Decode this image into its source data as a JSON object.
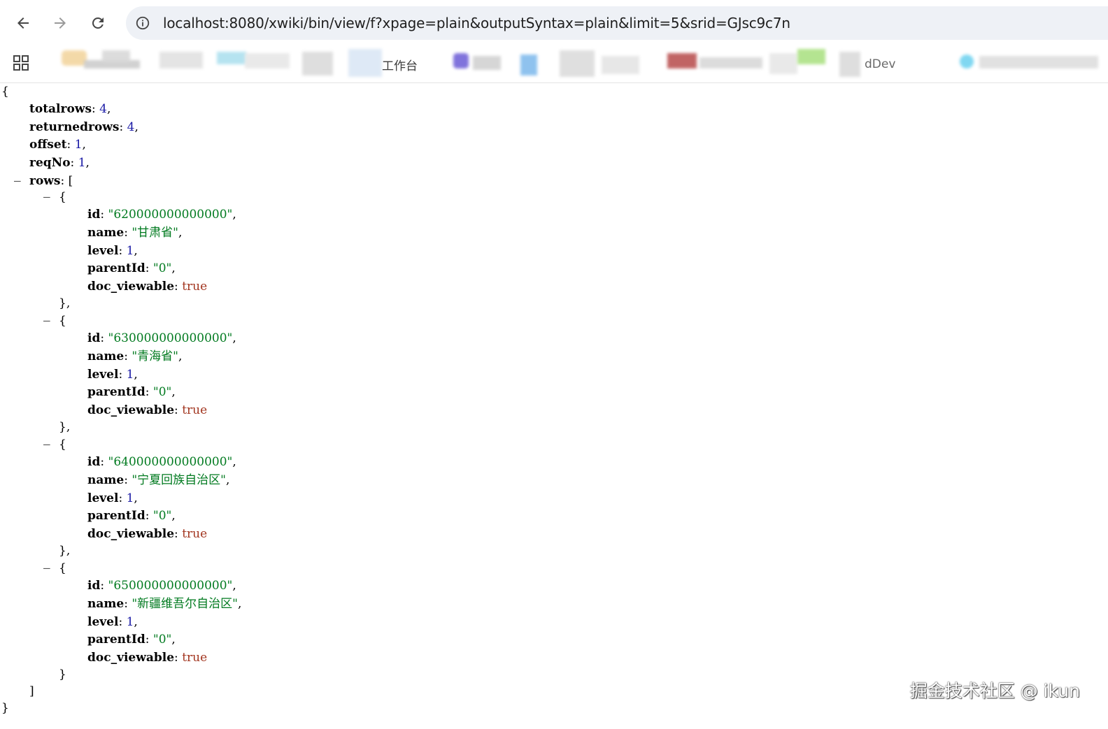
{
  "browser": {
    "url": "localhost:8080/xwiki/bin/view/f?xpage=plain&outputSyntax=plain&limit=5&srid=GJsc9c7n",
    "bookmarks": {
      "workbench_label": "工作台",
      "dev_label": "dDev"
    }
  },
  "punct": {
    "open_brace": "{",
    "close_brace": "}",
    "open_bracket": "[",
    "close_bracket": "]",
    "object_close_comma": "},",
    "toggle": "–"
  },
  "json": {
    "totalrows": {
      "key": "totalrows",
      "value": "4"
    },
    "returnedrows": {
      "key": "returnedrows",
      "value": "4"
    },
    "offset": {
      "key": "offset",
      "value": "1"
    },
    "reqNo": {
      "key": "reqNo",
      "value": "1"
    },
    "rows_key": "rows",
    "rows": [
      {
        "id": "\"620000000000000\"",
        "name": "\"甘肃省\"",
        "level": "1",
        "parentId": "\"0\"",
        "doc_viewable": "true"
      },
      {
        "id": "\"630000000000000\"",
        "name": "\"青海省\"",
        "level": "1",
        "parentId": "\"0\"",
        "doc_viewable": "true"
      },
      {
        "id": "\"640000000000000\"",
        "name": "\"宁夏回族自治区\"",
        "level": "1",
        "parentId": "\"0\"",
        "doc_viewable": "true"
      },
      {
        "id": "\"650000000000000\"",
        "name": "\"新疆维吾尔自治区\"",
        "level": "1",
        "parentId": "\"0\"",
        "doc_viewable": "true"
      }
    ],
    "field_keys": {
      "id": "id",
      "name": "name",
      "level": "level",
      "parentId": "parentId",
      "doc_viewable": "doc_viewable"
    }
  },
  "watermark": "掘金技术社区 @ ikun",
  "colors": {
    "string": "#007a1f",
    "number": "#1a1aa6",
    "boolean": "#a2351f",
    "omnibox": "#eef1f6"
  },
  "icons": [
    "back-arrow-icon",
    "forward-arrow-icon",
    "reload-icon",
    "site-info-icon",
    "apps-grid-icon"
  ]
}
